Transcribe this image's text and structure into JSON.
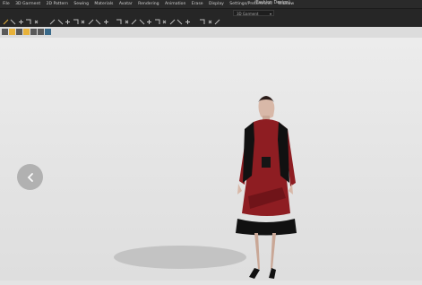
{
  "menubar": {
    "items": [
      "File",
      "3D Garment",
      "2D Pattern",
      "Sewing",
      "Materials",
      "Avatar",
      "Rendering",
      "Animation",
      "Erase",
      "Display",
      "Settings/Preferences",
      "Window"
    ],
    "extra": "(Fashion Design)"
  },
  "toolbar": {
    "mode_label": "3D Garment",
    "tool_icons": [
      "select-icon",
      "move-icon",
      "rotate-icon",
      "scale-icon",
      "point-icon",
      "line-icon",
      "pin-icon",
      "tack-icon",
      "fold-icon",
      "zip-icon",
      "cut-icon",
      "measure-icon",
      "drape-icon",
      "arrange-icon",
      "flatten-icon",
      "strengthen-icon",
      "weld-icon",
      "render-icon",
      "transform-icon",
      "camera-icon",
      "tape-icon",
      "grid-icon",
      "snap-icon",
      "symmetry-icon",
      "texture-icon",
      "settings-icon"
    ]
  },
  "subtoolbar": {
    "icons": [
      "avatar-icon",
      "garment-icon",
      "pattern-icon",
      "fabric-icon",
      "wire-icon",
      "lock-icon",
      "export-icon"
    ]
  },
  "viewport": {
    "back_button_label": "‹",
    "background_color": "#e8e8e8"
  },
  "colors": {
    "menubar": "#2a2a2a",
    "toolbar": "#262626",
    "dress_red": "#8e1d22",
    "dress_black": "#111111",
    "icon_yellow": "#e8b23a"
  }
}
